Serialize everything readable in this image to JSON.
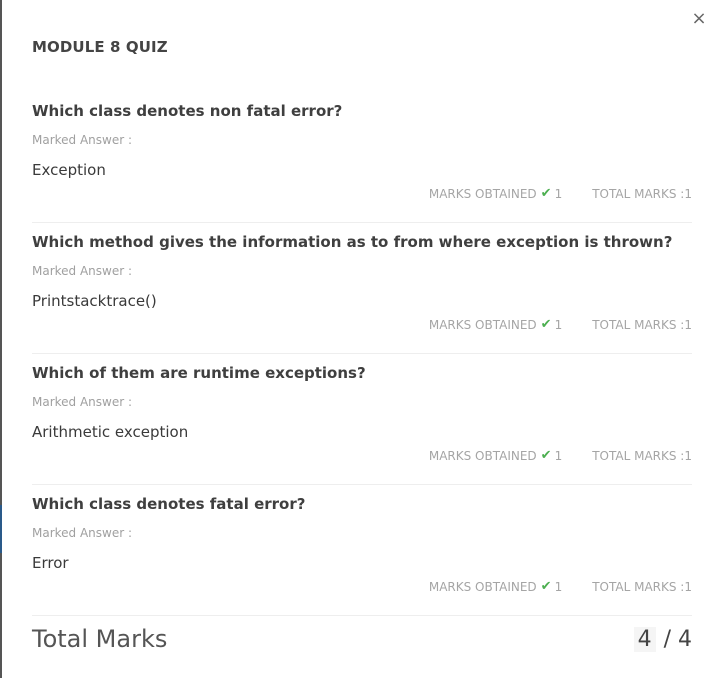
{
  "close_icon": "×",
  "quiz_title": "MODULE 8 QUIZ",
  "labels": {
    "marked_answer": "Marked Answer :",
    "marks_obtained": "MARKS OBTAINED",
    "total_marks_prefix": "TOTAL MARKS : "
  },
  "questions": [
    {
      "text": "Which class denotes non fatal error?",
      "answer": "Exception",
      "marks_obtained": "1",
      "total_marks": "1"
    },
    {
      "text": "Which method gives the information as to from where exception is thrown?",
      "answer": "Printstacktrace()",
      "marks_obtained": "1",
      "total_marks": "1"
    },
    {
      "text": "Which of them are runtime exceptions?",
      "answer": "Arithmetic exception",
      "marks_obtained": "1",
      "total_marks": "1"
    },
    {
      "text": "Which class denotes fatal error?",
      "answer": "Error",
      "marks_obtained": "1",
      "total_marks": "1"
    }
  ],
  "total": {
    "label": "Total Marks",
    "obtained": "4",
    "max": "/ 4"
  },
  "colors": {
    "check": "#4caf50",
    "muted_text": "#a5a5a5",
    "title_text": "#444444"
  },
  "icons": {
    "close": "close-icon",
    "check": "check-icon"
  }
}
